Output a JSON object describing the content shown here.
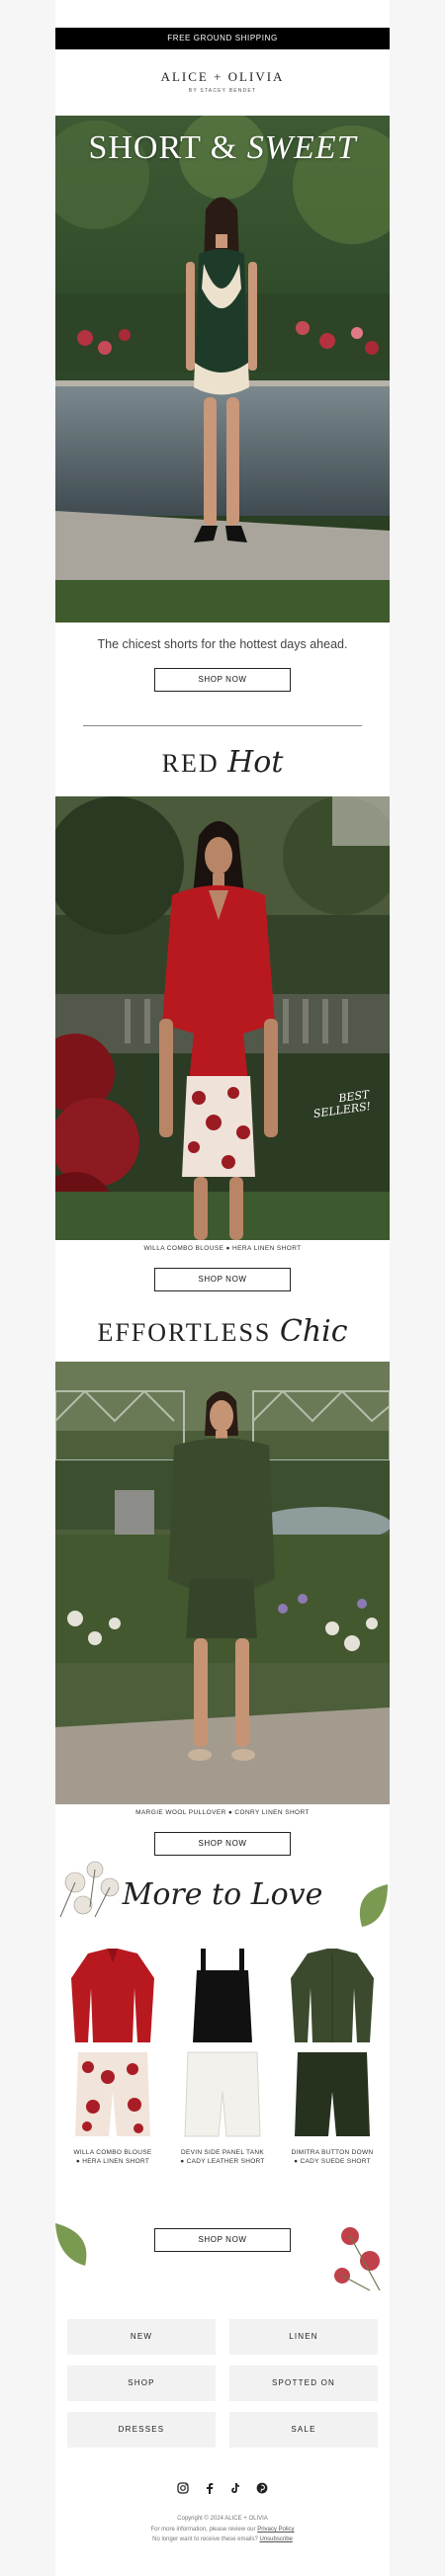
{
  "topbar": {
    "text": "FREE GROUND SHIPPING"
  },
  "brand": {
    "name": "ALICE + OLIVIA",
    "sub": "BY STACEY BENDET"
  },
  "hero": {
    "title_plain": "SHORT & ",
    "title_italic": "SWEET",
    "tagline": "The chicest shorts for the hottest days ahead.",
    "button": "SHOP NOW"
  },
  "red_hot": {
    "title_plain": "RED ",
    "title_script": "Hot",
    "caption": "WILLA COMBO BLOUSE  ●  HERA LINEN SHORT",
    "badge_line1": "BEST",
    "badge_line2": "SELLERS!",
    "button": "SHOP NOW"
  },
  "effortless": {
    "title_plain": "EFFORTLESS ",
    "title_script": "Chic",
    "caption": "MARGIE WOOL PULLOVER  ●  CONRY LINEN SHORT",
    "button": "SHOP NOW"
  },
  "more": {
    "title": "More to Love",
    "products": [
      {
        "line1": "WILLA COMBO BLOUSE",
        "line2": "● HERA LINEN SHORT"
      },
      {
        "line1": "DEVIN SIDE PANEL TANK",
        "line2": "● CADY LEATHER SHORT"
      },
      {
        "line1": "DIMITRA BUTTON DOWN",
        "line2": "● CADY SUEDE SHORT"
      }
    ],
    "button": "SHOP NOW"
  },
  "nav": [
    "NEW",
    "LINEN",
    "SHOP",
    "SPOTTED ON",
    "DRESSES",
    "SALE"
  ],
  "social_icons": [
    "instagram-icon",
    "facebook-icon",
    "tiktok-icon",
    "pinterest-icon"
  ],
  "footer": {
    "copyright": "Copyright © 2024 ALICE + OLIVIA",
    "line2_pre": "For more information, please review our ",
    "privacy": "Privacy Policy",
    "line3_pre": "No longer want to receive these emails? ",
    "unsubscribe": "Unsubscribe"
  },
  "colors": {
    "accent_red": "#b8191f",
    "black": "#000000",
    "green": "#3b4a2c"
  }
}
